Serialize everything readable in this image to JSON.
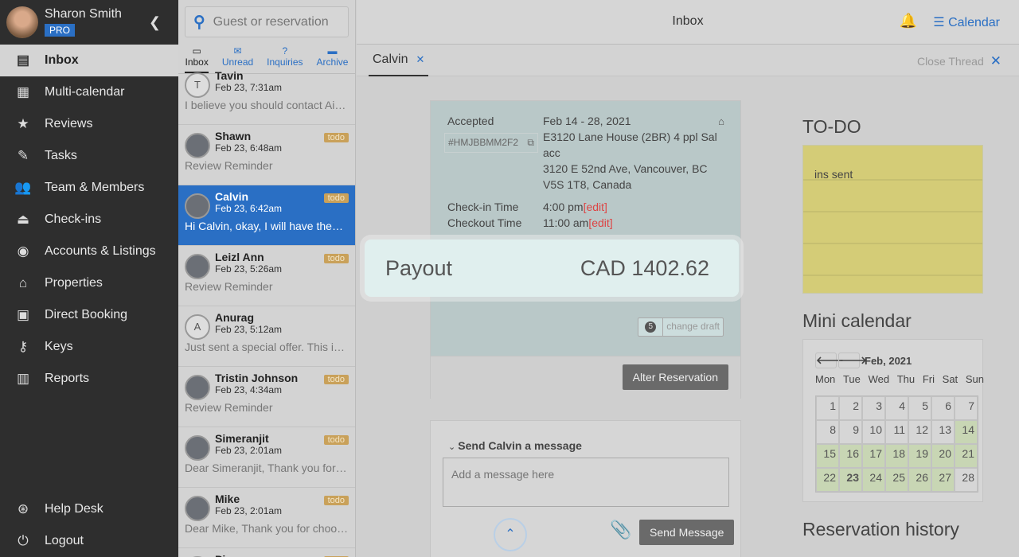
{
  "user": {
    "name": "Sharon Smith",
    "badge": "PRO"
  },
  "nav": [
    {
      "label": "Inbox",
      "icon": "inbox-icon",
      "glyph": "▤",
      "active": true
    },
    {
      "label": "Multi-calendar",
      "icon": "calendar-icon",
      "glyph": "▦"
    },
    {
      "label": "Reviews",
      "icon": "star-icon",
      "glyph": "★"
    },
    {
      "label": "Tasks",
      "icon": "tasks-icon",
      "glyph": "✎"
    },
    {
      "label": "Team & Members",
      "icon": "team-icon",
      "glyph": "👥"
    },
    {
      "label": "Check-ins",
      "icon": "bell-service-icon",
      "glyph": "⏏"
    },
    {
      "label": "Accounts & Listings",
      "icon": "account-icon",
      "glyph": "◉"
    },
    {
      "label": "Properties",
      "icon": "home-icon",
      "glyph": "⌂"
    },
    {
      "label": "Direct Booking",
      "icon": "code-icon",
      "glyph": "▣"
    },
    {
      "label": "Keys",
      "icon": "key-icon",
      "glyph": "⚷"
    },
    {
      "label": "Reports",
      "icon": "reports-icon",
      "glyph": "▥"
    }
  ],
  "bottom_nav": [
    {
      "label": "Help Desk",
      "glyph": "⊛"
    },
    {
      "label": "Logout",
      "glyph": "⏻"
    }
  ],
  "search": {
    "placeholder": "Guest or reservation"
  },
  "filter_tabs": [
    {
      "label": "Inbox",
      "glyph": "▭"
    },
    {
      "label": "Unread",
      "glyph": "✉"
    },
    {
      "label": "Inquiries",
      "glyph": "?"
    },
    {
      "label": "Archive",
      "glyph": "▬"
    }
  ],
  "conversations": [
    {
      "name": "Tavin",
      "date": "Feb 23, 7:31am",
      "preview": "I believe you should contact Airbnb",
      "initial": "T"
    },
    {
      "name": "Shawn",
      "date": "Feb 23, 6:48am",
      "preview": "Review Reminder",
      "todo": "todo"
    },
    {
      "name": "Calvin",
      "date": "Feb 23, 6:42am",
      "preview": "Hi Calvin, okay, I will have them ready",
      "todo": "todo",
      "selected": true
    },
    {
      "name": "Leizl Ann",
      "date": "Feb 23, 5:26am",
      "preview": "Review Reminder",
      "todo": "todo"
    },
    {
      "name": "Anurag",
      "date": "Feb 23, 5:12am",
      "preview": "Just sent a special offer. This is the",
      "initial": "A"
    },
    {
      "name": "Tristin Johnson",
      "date": "Feb 23, 4:34am",
      "preview": "Review Reminder",
      "todo": "todo"
    },
    {
      "name": "Simeranjit",
      "date": "Feb 23, 2:01am",
      "preview": "Dear Simeranjit, Thank you for choosing",
      "todo": "todo"
    },
    {
      "name": "Mike",
      "date": "Feb 23, 2:01am",
      "preview": "Dear Mike, Thank you for choosing",
      "todo": "todo"
    },
    {
      "name": "Piers",
      "date": "",
      "preview": "",
      "todo": "todo"
    }
  ],
  "header": {
    "title": "Inbox",
    "calendar_label": "Calendar"
  },
  "thread": {
    "tab": "Calvin",
    "close_label": "Close Thread"
  },
  "reservation": {
    "status": "Accepted",
    "code": "#HMJBBMM2F2",
    "dates": "Feb 14 - 28, 2021",
    "listing": "E3120 Lane House (2BR) 4 ppl Sal acc",
    "address": "3120 E 52nd Ave, Vancouver, BC V5S 1T8, Canada",
    "checkin_label": "Check-in Time",
    "checkin": "4:00 pm",
    "checkout_label": "Checkout Time",
    "checkout": "11:00 am",
    "edit": "[edit]",
    "payout_label": "Payout",
    "payout": "CAD 1402.62",
    "draft_count": "5",
    "draft_label": "change draft",
    "alter_label": "Alter Reservation"
  },
  "message": {
    "title": "Send Calvin a message",
    "placeholder": "Add a message here",
    "send_label": "Send Message"
  },
  "right": {
    "todo_title": "TO-DO",
    "todo_note": "ins sent",
    "mini_title": "Mini calendar",
    "history_title": "Reservation history"
  },
  "mini_calendar": {
    "month": "Feb, 2021",
    "weekdays": [
      "Mon",
      "Tue",
      "Wed",
      "Thu",
      "Fri",
      "Sat",
      "Sun"
    ],
    "booked_from": 14,
    "booked_to": 28,
    "days": 28,
    "today": 23
  },
  "colors": {
    "accent": "#2a6fc4",
    "todo": "#c9a15a",
    "booked": "#c8d6b4"
  }
}
